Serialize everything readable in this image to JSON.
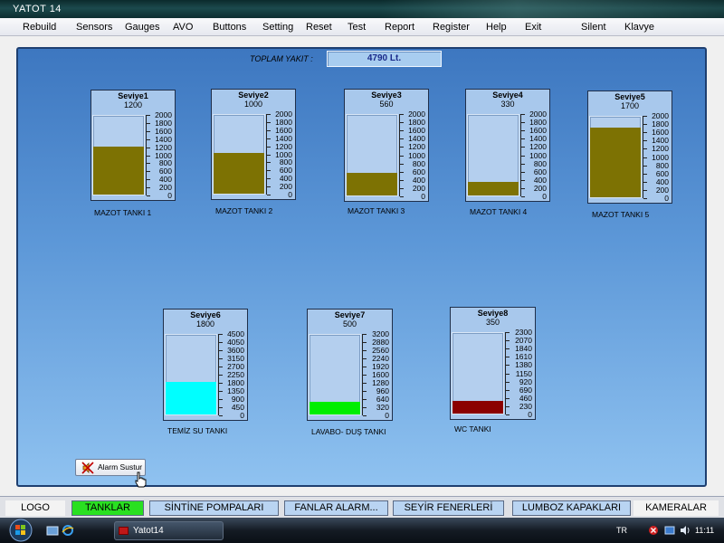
{
  "window": {
    "title": "YATOT  14"
  },
  "menu": [
    "Rebuild",
    "Sensors",
    "Gauges",
    "AVO",
    "Buttons",
    "Setting",
    "Reset",
    "Test",
    "Report",
    "Register",
    "Help",
    "Exit",
    "Silent",
    "Klavye"
  ],
  "total": {
    "label": "TOPLAM YAKIT  :",
    "value": "4790 Lt."
  },
  "gauges": [
    {
      "name": "Seviye1",
      "value": "1200",
      "max": 2000,
      "level": 1200,
      "fill_color": "#7d7203",
      "ticks": [
        "2000",
        "1800",
        "1600",
        "1400",
        "1200",
        "1000",
        "800",
        "600",
        "400",
        "200",
        "0"
      ],
      "tank": "MAZOT TANKI 1"
    },
    {
      "name": "Seviye2",
      "value": "1000",
      "max": 2000,
      "level": 1000,
      "fill_color": "#7d7203",
      "ticks": [
        "2000",
        "1800",
        "1600",
        "1400",
        "1200",
        "1000",
        "800",
        "600",
        "400",
        "200",
        "0"
      ],
      "tank": "MAZOT TANKI 2"
    },
    {
      "name": "Seviye3",
      "value": "560",
      "max": 2000,
      "level": 560,
      "fill_color": "#7d7203",
      "ticks": [
        "2000",
        "1800",
        "1600",
        "1400",
        "1200",
        "1000",
        "800",
        "600",
        "400",
        "200",
        "0"
      ],
      "tank": "MAZOT TANKI 3"
    },
    {
      "name": "Seviye4",
      "value": "330",
      "max": 2000,
      "level": 330,
      "fill_color": "#7d7203",
      "ticks": [
        "2000",
        "1800",
        "1600",
        "1400",
        "1200",
        "1000",
        "800",
        "600",
        "400",
        "200",
        "0"
      ],
      "tank": "MAZOT TANKI 4"
    },
    {
      "name": "Seviye5",
      "value": "1700",
      "max": 2000,
      "level": 1700,
      "fill_color": "#7d7203",
      "ticks": [
        "2000",
        "1800",
        "1600",
        "1400",
        "1200",
        "1000",
        "800",
        "600",
        "400",
        "200",
        "0"
      ],
      "tank": "MAZOT TANKI 5"
    },
    {
      "name": "Seviye6",
      "value": "1800",
      "max": 4500,
      "level": 1800,
      "fill_color": "#00ffff",
      "ticks": [
        "4500",
        "4050",
        "3600",
        "3150",
        "2700",
        "2250",
        "1800",
        "1350",
        "900",
        "450",
        "0"
      ],
      "tank": "TEMİZ SU TANKI"
    },
    {
      "name": "Seviye7",
      "value": "500",
      "max": 3200,
      "level": 500,
      "fill_color": "#00ee00",
      "ticks": [
        "3200",
        "2880",
        "2560",
        "2240",
        "1920",
        "1600",
        "1280",
        "960",
        "640",
        "320",
        "0"
      ],
      "tank": "LAVABO- DUŞ TANKI"
    },
    {
      "name": "Seviye8",
      "value": "350",
      "max": 2300,
      "level": 350,
      "fill_color": "#8b0000",
      "ticks": [
        "2300",
        "2070",
        "1840",
        "1610",
        "1380",
        "1150",
        "920",
        "690",
        "460",
        "230",
        "0"
      ],
      "tank": "WC TANKI"
    }
  ],
  "alarm_button": {
    "label": "Alarm Sustur",
    "icon": "speaker-muted-icon"
  },
  "tabs": [
    "LOGO",
    "TANKLAR",
    "SİNTİNE POMPALARI",
    "FANLAR ALARM...",
    "SEYİR  FENERLERİ",
    "LUMBOZ KAPAKLARI",
    "KAMERALAR"
  ],
  "active_tab": "TANKLAR",
  "taskbar": {
    "task_label": "Yatot14",
    "language": "TR",
    "clock": "11:11"
  }
}
